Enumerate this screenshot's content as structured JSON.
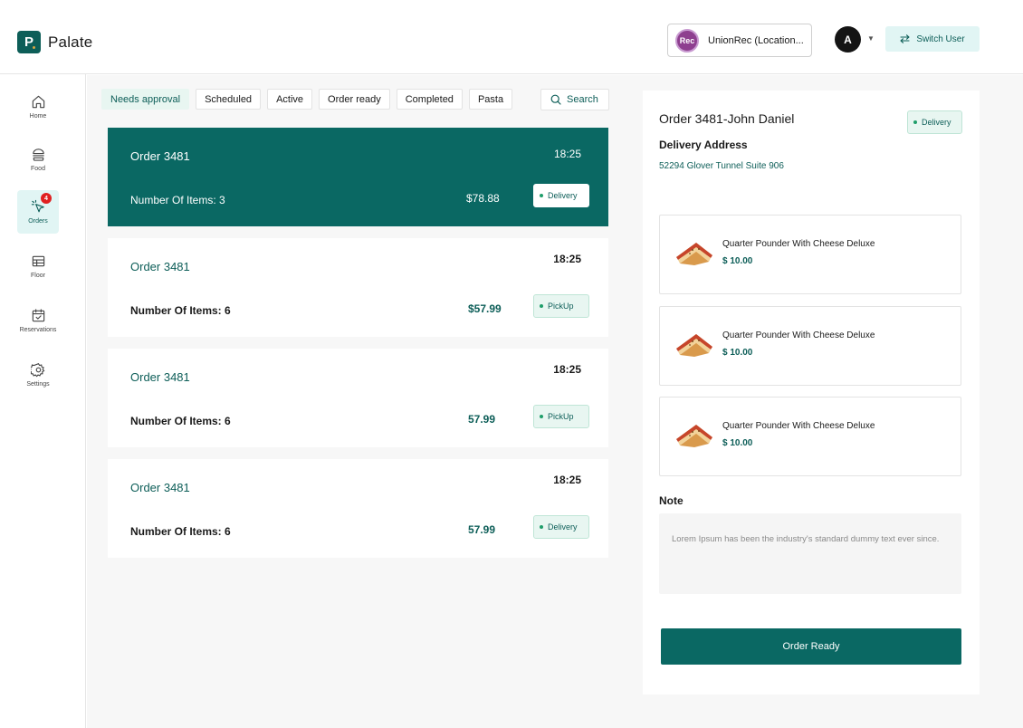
{
  "app": {
    "name": "Palate",
    "logo_letter": "P"
  },
  "header": {
    "location_badge": "Rec",
    "location_name": "UnionRec (Location...",
    "avatar_initial": "A",
    "switch_user_label": "Switch User"
  },
  "sidebar": {
    "items": [
      {
        "label": "Home",
        "icon": "home-icon"
      },
      {
        "label": "Food",
        "icon": "burger-icon"
      },
      {
        "label": "Orders",
        "icon": "cursor-click-icon",
        "badge": "4",
        "active": true
      },
      {
        "label": "Floor",
        "icon": "table-icon"
      },
      {
        "label": "Reservations",
        "icon": "calendar-check-icon"
      },
      {
        "label": "Settings",
        "icon": "gear-icon"
      }
    ]
  },
  "tabs": [
    {
      "label": "Needs approval",
      "active": true
    },
    {
      "label": "Scheduled"
    },
    {
      "label": "Active"
    },
    {
      "label": "Order ready"
    },
    {
      "label": "Completed"
    },
    {
      "label": "Pasta"
    }
  ],
  "search": {
    "label": "Search"
  },
  "orders": [
    {
      "title": "Order 3481",
      "time": "18:25",
      "items": "Number Of Items: 3",
      "price": "$78.88",
      "type": "Delivery",
      "active": true
    },
    {
      "title": "Order 3481",
      "time": "18:25",
      "items": "Number Of Items: 6",
      "price": "$57.99",
      "type": "PickUp"
    },
    {
      "title": "Order 3481",
      "time": "18:25",
      "items": "Number Of Items: 6",
      "price": "57.99",
      "type": "PickUp"
    },
    {
      "title": "Order 3481",
      "time": "18:25",
      "items": "Number Of Items: 6",
      "price": "57.99",
      "type": "Delivery"
    }
  ],
  "detail": {
    "title": "Order 3481-John Daniel",
    "type": "Delivery",
    "address_label": "Delivery Address",
    "address": "52294 Glover Tunnel Suite 906",
    "items": [
      {
        "name": "Quarter Pounder With Cheese Deluxe",
        "price": "$ 10.00"
      },
      {
        "name": "Quarter Pounder With Cheese Deluxe",
        "price": "$ 10.00"
      },
      {
        "name": "Quarter Pounder With Cheese Deluxe",
        "price": "$ 10.00"
      }
    ],
    "note_label": "Note",
    "note_text": "Lorem Ipsum has been the industry's standard dummy text ever since.",
    "order_ready_label": "Order Ready"
  },
  "colors": {
    "brand": "#0a6863",
    "accent_light": "#e1f5f4",
    "badge": "#e02020"
  }
}
